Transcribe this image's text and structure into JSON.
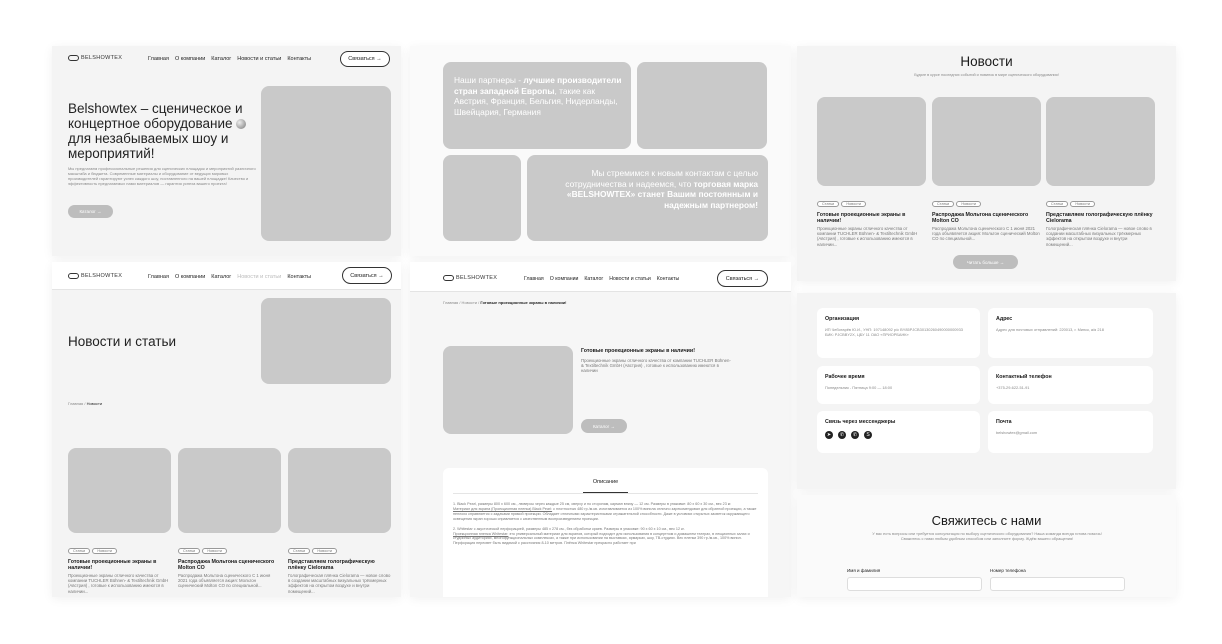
{
  "brand": {
    "logo": "BELSHOWTEX"
  },
  "nav": {
    "items": [
      "Главная",
      "О компании",
      "Каталог",
      "Новости и статьи",
      "Контакты"
    ],
    "contact_btn": "Связаться →"
  },
  "hero": {
    "title_1": "Belshowtex – сценическое и концертное оборудование",
    "title_2": "для незабываемых шоу и мероприятий!",
    "text": "Мы предлагаем профессиональные решения для сценических площадок и мероприятий различного масштаба и бюджета. Современные материалы и оборудование от ведущих мировых производителей гарантируют успех каждого шоу, поставленного на вашей площадке! Качество и эффективность предлагаемых нами материалов — гарантия успеха вашего проекта!",
    "btn": "Каталог →"
  },
  "partners": {
    "text_plain_1": "Наши партнеры - ",
    "text_bold_1": "лучшие производители стран западной Европы",
    "text_plain_2": ", такие как Австрия, Франция, Бельгия, Нидерланды, Швейцария, Германия",
    "goal_plain": "Мы стремимся к новым контактам с целью сотрудничества и надеемся, что ",
    "goal_bold": "торговая марка «BELSHOWTEX» станет Вашим постоянным и надежным партнером!"
  },
  "news_page": {
    "title": "Новости и статьи",
    "breadcrumb_home": "Главная / ",
    "breadcrumb_current": "Новости"
  },
  "news": {
    "title": "Новости",
    "subtitle": "Будьте в курсе последних событий и новинок в мире сценического оборудования!",
    "read_more": "Читать больше →",
    "cards": [
      {
        "tags": [
          "Статьи",
          "Новости"
        ],
        "title": "Готовые проекционные экраны в наличии!",
        "text": "Проекционные экраны отличного качества от компании TUCHLER Bühnen- & Textiltechnik GmbH (Австрия) , готовые к использованию имеются в наличии..."
      },
      {
        "tags": [
          "Статьи",
          "Новости"
        ],
        "title": "Распродажа Мольтона сценического Molton CO",
        "text": "Распродажа Мольтона сценического C 1 июня 2021 года объявляется акция: Мольтон сценический Molton CO по специальной..."
      },
      {
        "tags": [
          "Статьи",
          "Новости"
        ],
        "title": "Представляем голографическую плёнку Cielorama",
        "text": "Голографическая плёнка Cielorama — новое слово в создании масштабных визуальных трёхмерных эффектов на открытом воздухе и внутри помещений..."
      }
    ]
  },
  "article": {
    "breadcrumb_plain": "Главная / Новости / ",
    "breadcrumb_current": "Готовые проекционные экраны в наличии!",
    "title": "Готовые проекционные экраны в наличии!",
    "text": "Проекционные экраны отличного качества от компании TUCHLER Bühnen- & Textiltechnik GmbH (Австрия) , готовые к использованию имеются в наличии",
    "btn": "Каталог →",
    "desc_tab": "Описание",
    "desc_1": "1. Black Pearl, размеры 800 х 600 см., люверсы через каждые 25 см, сверху и по сторонам, карман внизу — 12 см. Размеры в упаковке: 80 х 60 х 30 см., вес 23 кг.",
    "desc_1_link": "Материал для экрана (Проекционная пленка) Black Pearl:",
    "desc_1b": "с плотностью 480 гр./м.кв. изготавливается из 100% винила отлично зарекомендовал для обратной проекции, а также неплохо справляется с задачами прямой проекции. Обладает отличными характеристиками отражательной способности. Даже в условиях открытых засветок окружающего освещения экран хорошо справляется с качественным воспроизведением проекции.",
    "desc_2": "2. Whitestar с акустической перфорацией, размеры 485 х 278 см., без обработки краев. Размеры в упаковке: 90 х 60 х 10 см., вес 12 кг.",
    "desc_2_link": "Проекционная пленка Whitestar:",
    "desc_2b": "это универсальный материал для экранов, который подходит для использования в концертном и домашнем театрах, в лекционных залах и студийных аудиториях, многофункциональных комплексах, а также при использовании на выставках, ярмарках, шоу, ТВ-студиях. Вес пленки 390 гр./м.кв., 100% винил. Перфорация пересвет быть видимой с расстояния 8-10 метров. Плёнка Whitestar прекрасно работает при"
  },
  "contacts": {
    "org_h": "Организация",
    "org_t": "ИП Чеботарёв Ю.И., УНП: 197148092 р/с BY85PJCB30130260490000000933 БИК: PJCBBY2X, ЦБУ 11 ОАО «ПРИОРБАНК»",
    "addr_h": "Адрес",
    "addr_t": "Адрес для почтовых отправлений: 220013, г. Минск, а/я 218",
    "hours_h": "Рабочее время",
    "hours_t": "Понедельник - Пятница 9:00 — 18:00",
    "phone_h": "Контактный телефон",
    "phone_t": "+375-29-622-51-91",
    "msg_h": "Связь через мессенджеры",
    "mail_h": "Почта",
    "mail_t": "belshowtex@gmail.com"
  },
  "contact_form": {
    "title": "Свяжитесь с нами",
    "text": "У вас есть вопросы или требуется консультация по выбору сценического оборудования? Наша команда всегда готова помочь! Свяжитесь с нами любым удобным способом или заполните форму. Ждём вашего обращения!",
    "name_label": "Имя и фамилия",
    "phone_label": "Номер телефона"
  },
  "messenger_icons": [
    "telegram-icon",
    "viber-icon",
    "whatsapp-icon",
    "skype-icon"
  ]
}
